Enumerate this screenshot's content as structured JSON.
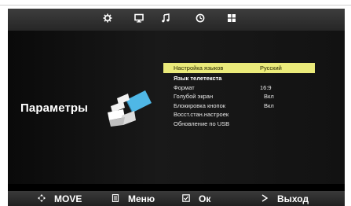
{
  "tabs": [
    {
      "icon": "gear-icon"
    },
    {
      "icon": "monitor-icon"
    },
    {
      "icon": "music-note-icon"
    },
    {
      "icon": "clock-icon"
    },
    {
      "icon": "grid-icon"
    }
  ],
  "section": {
    "title": "Параметры"
  },
  "menu": {
    "items": [
      {
        "label": "Настройка языков",
        "value": "Русский"
      },
      {
        "label": "Язык телетекста",
        "value": ""
      },
      {
        "label": "Формат",
        "value": "16:9"
      },
      {
        "label": "Голубой экран",
        "value": "Вкл"
      },
      {
        "label": "Блокировка кнопок",
        "value": "Вкл"
      },
      {
        "label": "Восст.стан.настроек",
        "value": ""
      },
      {
        "label": "Обновление по USB",
        "value": ""
      }
    ]
  },
  "hints": {
    "move": "MOVE",
    "menu": "Меню",
    "ok": "Ок",
    "exit": "Выход"
  },
  "colors": {
    "highlight": "#eaea7a",
    "logo_accent": "#4fb7e6"
  }
}
